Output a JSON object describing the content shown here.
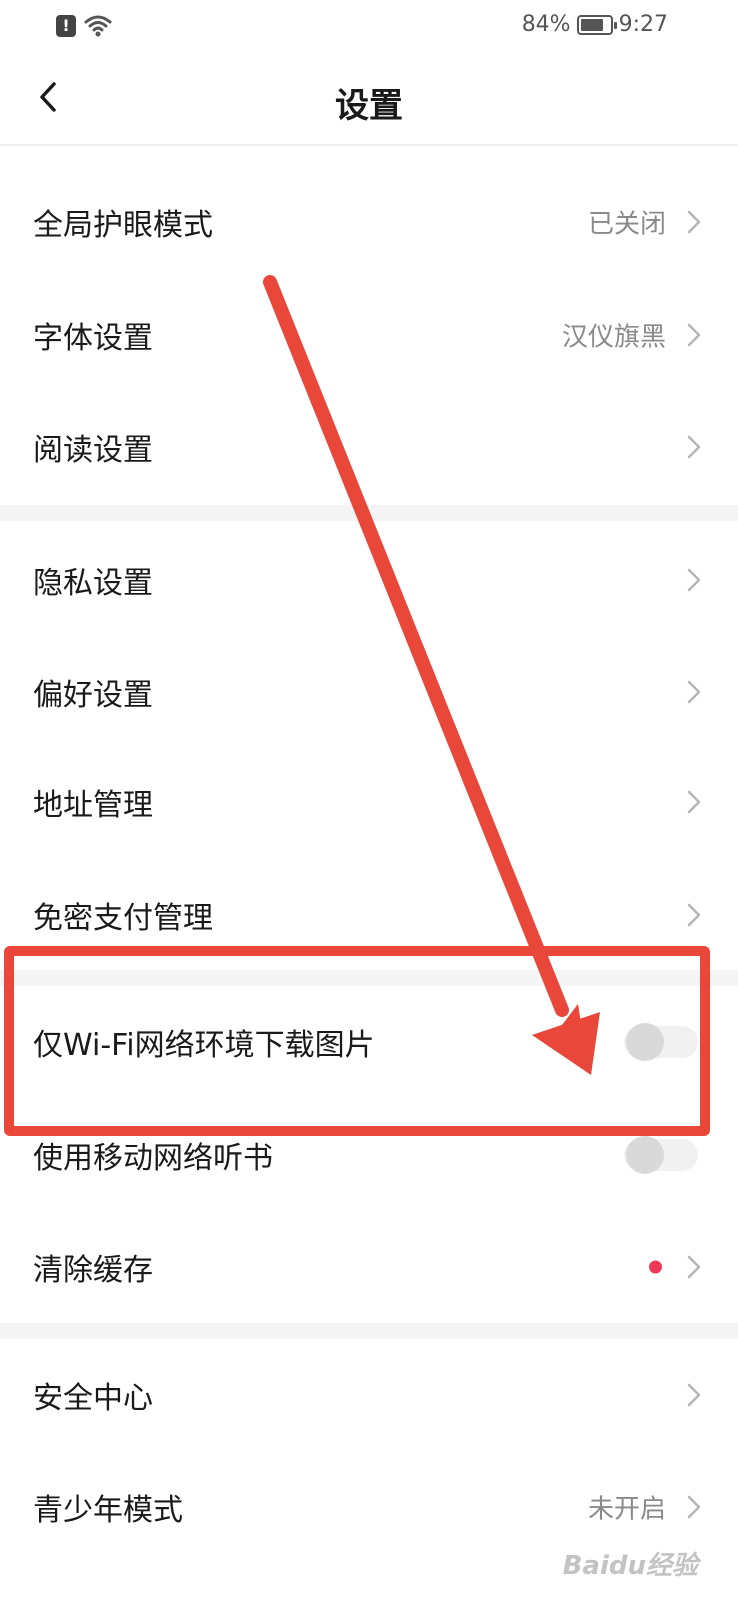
{
  "status_bar": {
    "battery_percent_label": "84%",
    "battery_level": 0.84,
    "time": "9:27",
    "icons": [
      "alert-icon",
      "wifi-icon",
      "battery-icon"
    ]
  },
  "nav": {
    "title": "设置",
    "back_icon": "chevron-left-icon"
  },
  "settings": {
    "eye_protection": {
      "label": "全局护眼模式",
      "value": "已关闭"
    },
    "font": {
      "label": "字体设置",
      "value": "汉仪旗黑"
    },
    "reading": {
      "label": "阅读设置"
    },
    "privacy": {
      "label": "隐私设置"
    },
    "preference": {
      "label": "偏好设置"
    },
    "address": {
      "label": "地址管理"
    },
    "password_free_pay": {
      "label": "免密支付管理"
    },
    "wifi_images": {
      "label": "仅Wi-Fi网络环境下载图片",
      "enabled": false
    },
    "mobile_listen": {
      "label": "使用移动网络听书",
      "enabled": false
    },
    "clear_cache": {
      "label": "清除缓存",
      "has_badge": true
    },
    "security": {
      "label": "安全中心"
    },
    "teen_mode": {
      "label": "青少年模式",
      "value": "未开启"
    }
  },
  "colors": {
    "annotation": "#e8473a",
    "badge": "#f03a55",
    "toggle_off_track": "#f1f1f1",
    "toggle_off_knob": "#d9d9d9"
  },
  "watermark": "Baidu经验"
}
